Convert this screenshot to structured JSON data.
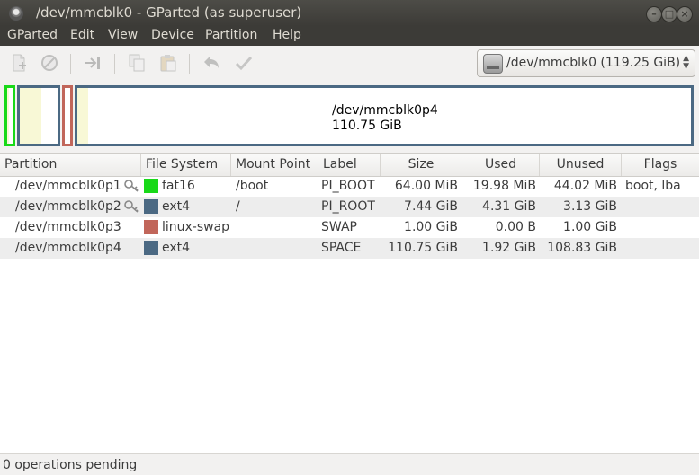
{
  "window": {
    "title": "/dev/mmcblk0 - GParted (as superuser)"
  },
  "menubar": [
    "GParted",
    "Edit",
    "View",
    "Device",
    "Partition",
    "Help"
  ],
  "toolbar": {
    "icons": [
      "new-partition-icon",
      "delete-partition-icon",
      "resize-move-icon",
      "copy-icon",
      "paste-icon",
      "undo-icon",
      "apply-icon"
    ]
  },
  "device_selector": {
    "value": "/dev/mmcblk0  (119.25 GiB)"
  },
  "disk_map": {
    "selected_label": "/dev/mmcblk0p4",
    "selected_size": "110.75 GiB",
    "colors": {
      "fat16": "#18d918",
      "ext4": "#4b6983",
      "linux-swap": "#c1665a",
      "used": "#f8f8d6"
    }
  },
  "table": {
    "headers": [
      "Partition",
      "File System",
      "Mount Point",
      "Label",
      "Size",
      "Used",
      "Unused",
      "Flags"
    ],
    "rows": [
      {
        "partition": "/dev/mmcblk0p1",
        "locked": true,
        "fs": "fat16",
        "fs_color": "#18d918",
        "mount": "/boot",
        "label": "PI_BOOT",
        "size": "64.00 MiB",
        "used": "19.98 MiB",
        "unused": "44.02 MiB",
        "flags": "boot, lba"
      },
      {
        "partition": "/dev/mmcblk0p2",
        "locked": true,
        "fs": "ext4",
        "fs_color": "#4b6983",
        "mount": "/",
        "label": "PI_ROOT",
        "size": "7.44 GiB",
        "used": "4.31 GiB",
        "unused": "3.13 GiB",
        "flags": ""
      },
      {
        "partition": "/dev/mmcblk0p3",
        "locked": false,
        "fs": "linux-swap",
        "fs_color": "#c1665a",
        "mount": "",
        "label": "SWAP",
        "size": "1.00 GiB",
        "used": "0.00 B",
        "unused": "1.00 GiB",
        "flags": ""
      },
      {
        "partition": "/dev/mmcblk0p4",
        "locked": false,
        "fs": "ext4",
        "fs_color": "#4b6983",
        "mount": "",
        "label": "SPACE",
        "size": "110.75 GiB",
        "used": "1.92 GiB",
        "unused": "108.83 GiB",
        "flags": ""
      }
    ]
  },
  "status": {
    "text": "0 operations pending"
  }
}
